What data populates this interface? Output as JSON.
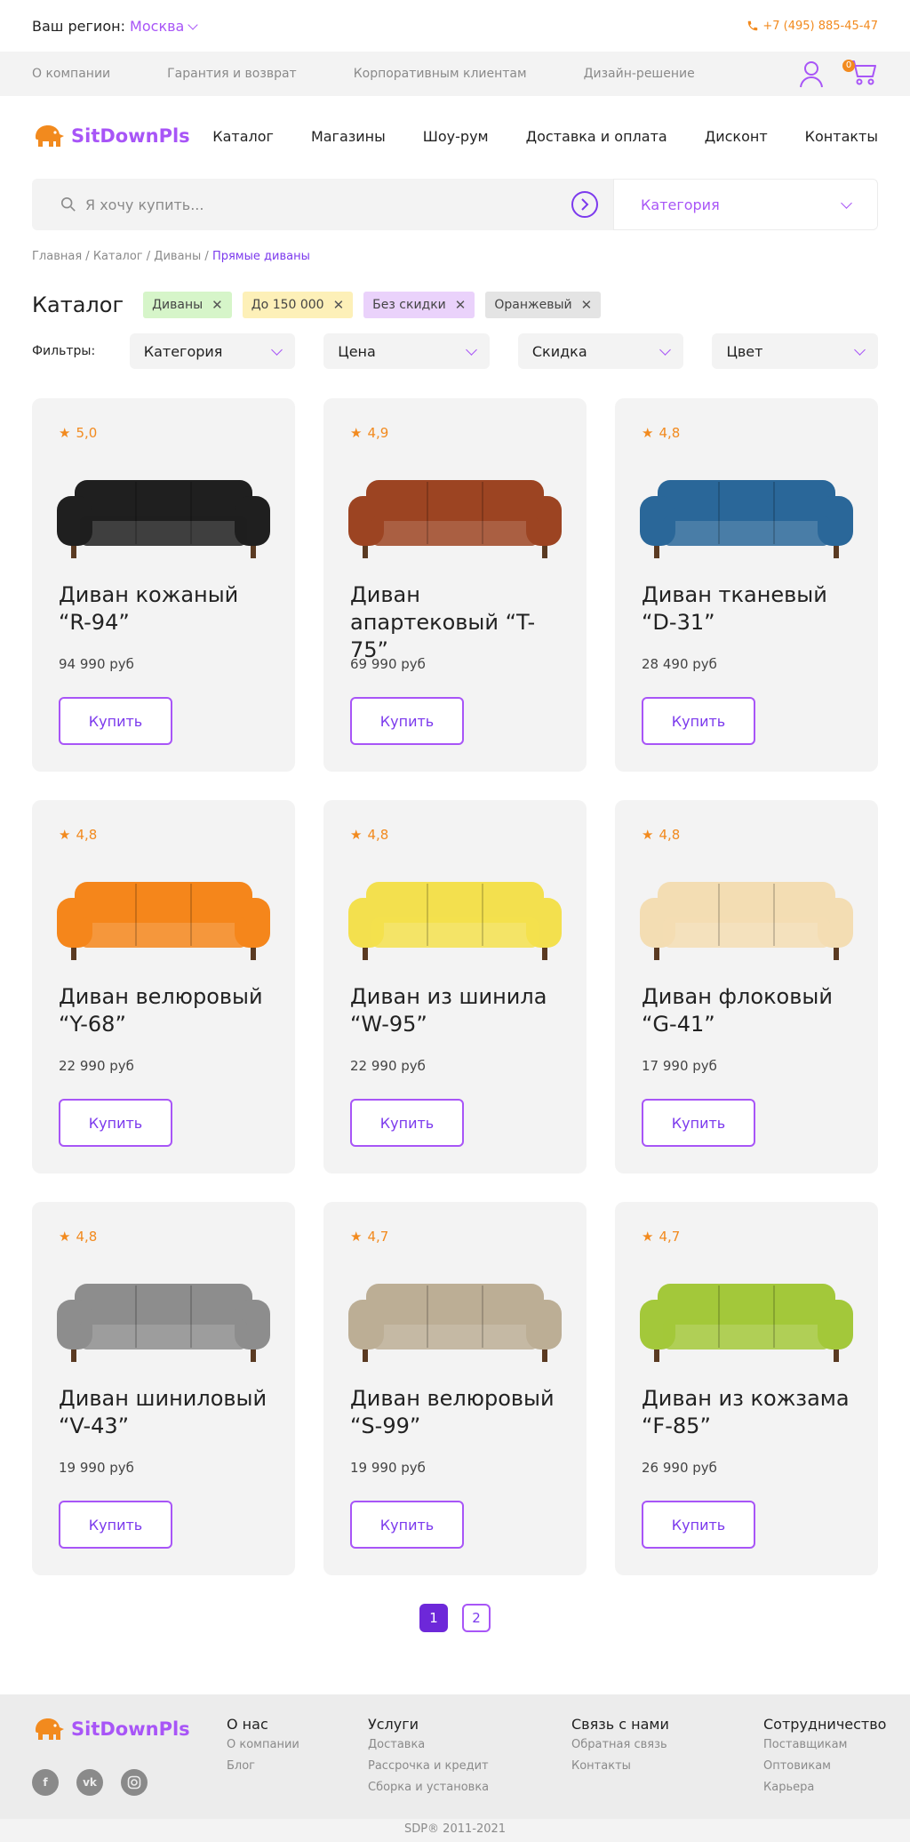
{
  "header": {
    "region_label": "Ваш регион:",
    "region_city": "Москва",
    "phone": "+7 (495) 885-45-47"
  },
  "subnav": {
    "links": [
      "О компании",
      "Гарантия и возврат",
      "Корпоративным клиентам",
      "Дизайн-решение"
    ],
    "cart_count": "0"
  },
  "brand": {
    "name": "SitDownPls"
  },
  "mainnav": [
    "Каталог",
    "Магазины",
    "Шоу-рум",
    "Доставка и оплата",
    "Дисконт",
    "Контакты"
  ],
  "search": {
    "placeholder": "Я хочу купить...",
    "category": "Категория"
  },
  "breadcrumbs": [
    "Главная",
    "Каталог",
    "Диваны",
    "Прямые диваны"
  ],
  "catalog": {
    "title": "Каталог",
    "chips": [
      "Диваны",
      "До 150 000",
      "Без скидки",
      "Оранжевый"
    ],
    "filters_label": "Фильтры:",
    "filters": [
      "Категория",
      "Цена",
      "Скидка",
      "Цвет"
    ]
  },
  "products": [
    {
      "rating": "5,0",
      "name": "Диван кожаный “R-94”",
      "price": "94 990 руб",
      "buy": "Купить",
      "color": "#1f1f1f"
    },
    {
      "rating": "4,9",
      "name": "Диван апартековый “T-75”",
      "price": "69 990 руб",
      "buy": "Купить",
      "color": "#9c4422"
    },
    {
      "rating": "4,8",
      "name": "Диван тканевый “D-31”",
      "price": "28 490 руб",
      "buy": "Купить",
      "color": "#2a6799"
    },
    {
      "rating": "4,8",
      "name": "Диван велюровый “Y-68”",
      "price": "22 990 руб",
      "buy": "Купить",
      "color": "#f5861b"
    },
    {
      "rating": "4,8",
      "name": "Диван из шинила “W-95”",
      "price": "22 990 руб",
      "buy": "Купить",
      "color": "#f3e04e"
    },
    {
      "rating": "4,8",
      "name": "Диван флоковый “G-41”",
      "price": "17 990 руб",
      "buy": "Купить",
      "color": "#f3ddb3"
    },
    {
      "rating": "4,8",
      "name": "Диван шиниловый “V-43”",
      "price": "19 990 руб",
      "buy": "Купить",
      "color": "#8d8d8d"
    },
    {
      "rating": "4,7",
      "name": "Диван велюровый “S-99”",
      "price": "19 990 руб",
      "buy": "Купить",
      "color": "#bcae95"
    },
    {
      "rating": "4,7",
      "name": "Диван из кожзама “F-85”",
      "price": "26 990 руб",
      "buy": "Купить",
      "color": "#a3c83a"
    }
  ],
  "pagination": [
    "1",
    "2"
  ],
  "footer": {
    "columns": [
      {
        "title": "О нас",
        "links": [
          "О компании",
          "Блог"
        ]
      },
      {
        "title": "Услуги",
        "links": [
          "Доставка",
          "Рассрочка и кредит",
          "Сборка и установка"
        ]
      },
      {
        "title": "Связь с нами",
        "links": [
          "Обратная связь",
          "Контакты"
        ]
      },
      {
        "title": "Сотрудничество",
        "links": [
          "Поставщикам",
          "Оптовикам",
          "Карьера"
        ]
      }
    ],
    "copyright": "SDP®   2011-2021"
  },
  "colors": {
    "accent": "#a855f7",
    "accent_dark": "#6d28d9",
    "orange": "#f28a1e"
  },
  "icons": [
    "chevron-down-icon",
    "phone-icon",
    "user-icon",
    "cart-icon",
    "elephant-logo-icon",
    "search-icon",
    "arrow-right-circle-icon",
    "close-icon",
    "star-icon",
    "facebook-icon",
    "vk-icon",
    "instagram-icon"
  ]
}
